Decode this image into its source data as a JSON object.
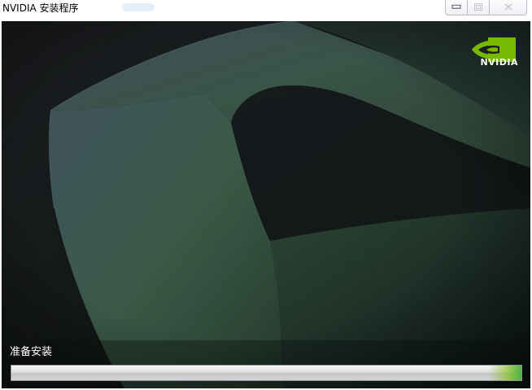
{
  "window": {
    "title": "NVIDIA 安装程序",
    "controls": {
      "minimize_icon": "minimize-icon",
      "maximize_icon": "maximize-icon",
      "close_icon": "close-icon"
    }
  },
  "branding": {
    "logo_text": "NVIDIA",
    "logo_icon": "nvidia-eye-icon",
    "accent_color": "#76b900"
  },
  "installer": {
    "status_text": "准备安装",
    "progress": 1.0
  }
}
